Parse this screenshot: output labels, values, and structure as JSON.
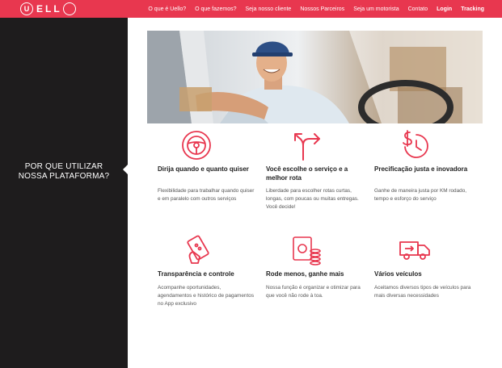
{
  "brand": {
    "name": "UELLO",
    "logo_letters": "ELL",
    "accent": "#e8374f"
  },
  "nav": {
    "items": [
      {
        "label": "O que é Uello?",
        "bold": false
      },
      {
        "label": "O que fazemos?",
        "bold": false
      },
      {
        "label": "Seja nosso cliente",
        "bold": false
      },
      {
        "label": "Nossos Parceiros",
        "bold": false
      },
      {
        "label": "Seja um motorista",
        "bold": false
      },
      {
        "label": "Contato",
        "bold": false
      },
      {
        "label": "Login",
        "bold": true
      },
      {
        "label": "Tracking",
        "bold": true
      }
    ]
  },
  "side": {
    "title": "POR QUE UTILIZAR NOSSA PLATAFORMA?",
    "background": "#1e1c1d"
  },
  "hero": {
    "icon": "driver-photo"
  },
  "features": [
    {
      "icon": "steering-wheel-icon",
      "title": "Dirija quando e quanto quiser",
      "text": "Flexibilidade para trabalhar quando quiser e em paralelo com outros serviços"
    },
    {
      "icon": "route-arrows-icon",
      "title": "Você escolhe o serviço e a melhor rota",
      "text": "Liberdade para escolher rotas curtas, longas, com poucas ou muitas entregas. Você decide!"
    },
    {
      "icon": "dollar-clock-icon",
      "title": "Precificação justa e inovadora",
      "text": "Ganhe de maneira justa por KM rodado, tempo e esforço do serviço"
    },
    {
      "icon": "phone-in-hand-icon",
      "title": "Transparência e controle",
      "text": "Acompanhe oportunidades, agendamentos e histórico de pagamentos no App exclusivo"
    },
    {
      "icon": "money-stack-icon",
      "title": "Rode menos, ganhe mais",
      "text": "Nossa função é organizar e otimizar para que você não rode à toa."
    },
    {
      "icon": "delivery-truck-icon",
      "title": "Vários veículos",
      "text": "Aceitamos diversos tipos de veículos para mais diversas necessidades"
    }
  ]
}
